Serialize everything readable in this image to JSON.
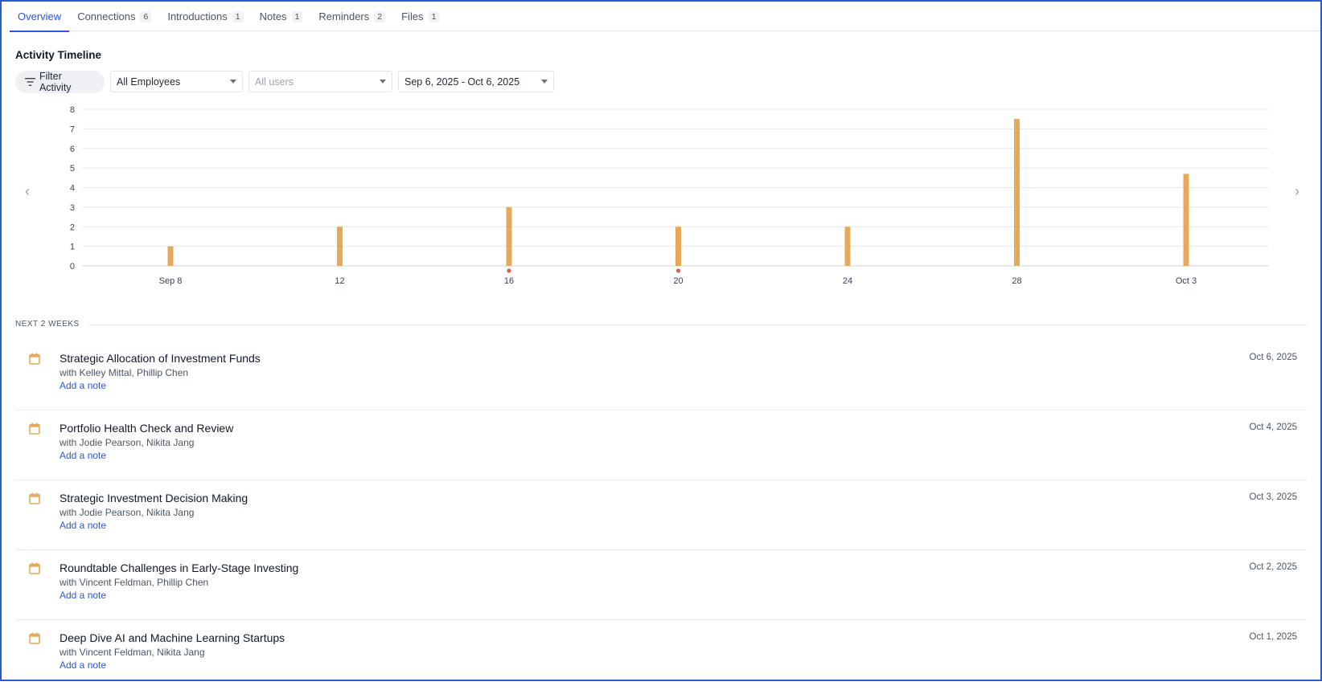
{
  "tabs": [
    {
      "label": "Overview",
      "count": "",
      "active": true
    },
    {
      "label": "Connections",
      "count": "6"
    },
    {
      "label": "Introductions",
      "count": "1"
    },
    {
      "label": "Notes",
      "count": "1"
    },
    {
      "label": "Reminders",
      "count": "2"
    },
    {
      "label": "Files",
      "count": "1"
    }
  ],
  "section_title": "Activity Timeline",
  "filters": {
    "filter_button": "Filter Activity",
    "employees_value": "All Employees",
    "users_placeholder": "All users",
    "date_range": "Sep 6, 2025 - Oct 6, 2025"
  },
  "chart_data": {
    "type": "bar",
    "x": [
      "Sep 8",
      "Sep 12",
      "Sep 16",
      "Sep 20",
      "Sep 24",
      "Sep 28",
      "Oct 3"
    ],
    "values": [
      1,
      2,
      3,
      2,
      2,
      7.5,
      4.7
    ],
    "tick_labels": [
      "Sep 8",
      "12",
      "16",
      "20",
      "24",
      "28",
      "Oct 3"
    ],
    "markers": [
      "Sep 16",
      "Sep 20"
    ],
    "ylim": [
      0,
      8
    ],
    "yticks": [
      0,
      1,
      2,
      3,
      4,
      5,
      6,
      7,
      8
    ],
    "grid": true,
    "bar_color": "#e8a85a",
    "marker_color": "#e05a4e",
    "title": "",
    "xlabel": "",
    "ylabel": ""
  },
  "list": {
    "section_label": "NEXT 2 WEEKS",
    "items": [
      {
        "title": "Strategic Allocation of Investment Funds",
        "with": "with Kelley Mittal, Phillip Chen",
        "note_link": "Add a note",
        "date": "Oct 6, 2025"
      },
      {
        "title": "Portfolio Health Check and Review",
        "with": "with Jodie Pearson, Nikita Jang",
        "note_link": "Add a note",
        "date": "Oct 4, 2025"
      },
      {
        "title": "Strategic Investment Decision Making",
        "with": "with Jodie Pearson, Nikita Jang",
        "note_link": "Add a note",
        "date": "Oct 3, 2025"
      },
      {
        "title": "Roundtable Challenges in Early-Stage Investing",
        "with": "with Vincent Feldman, Phillip Chen",
        "note_link": "Add a note",
        "date": "Oct 2, 2025"
      },
      {
        "title": "Deep Dive AI and Machine Learning Startups",
        "with": "with Vincent Feldman, Nikita Jang",
        "note_link": "Add a note",
        "date": "Oct 1, 2025"
      }
    ]
  },
  "colors": {
    "accent": "#2f55d4",
    "calendar_icon": "#e8a85a",
    "frame": "#2a5bd7"
  }
}
